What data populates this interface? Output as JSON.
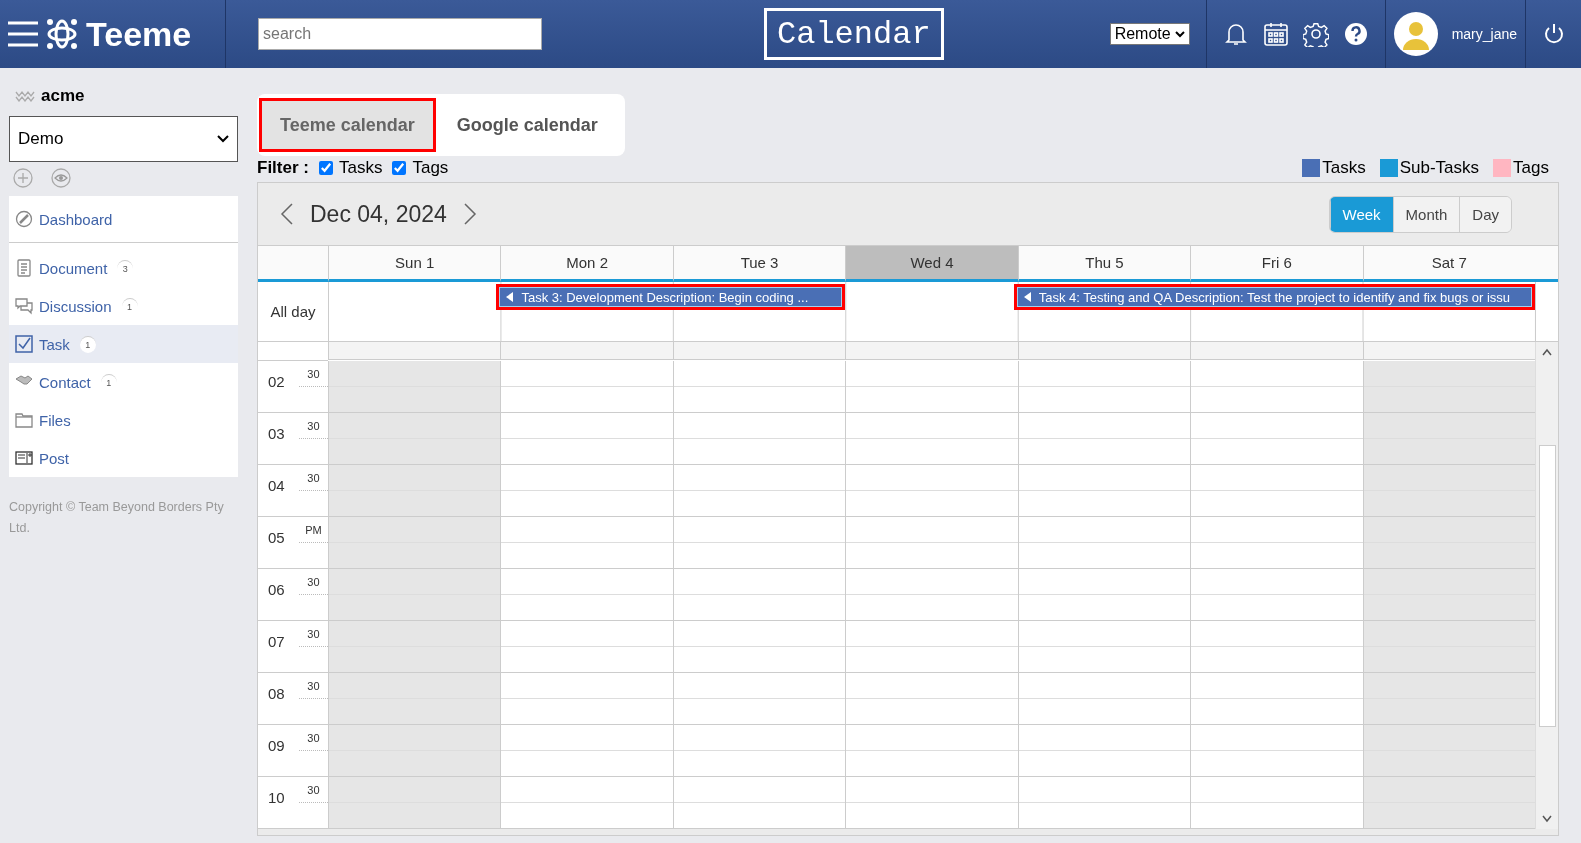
{
  "header": {
    "brand": "Teeme",
    "search": {
      "placeholder": "search"
    },
    "page_title": "Calendar",
    "mode_select": "Remote",
    "user_name": "mary_jane"
  },
  "sidebar": {
    "workspace": "acme",
    "space_select": "Demo",
    "items": [
      {
        "kind": "dashboard",
        "label": "Dashboard",
        "selected": false
      },
      {
        "kind": "document",
        "label": "Document",
        "count": "3",
        "selected": false
      },
      {
        "kind": "discussion",
        "label": "Discussion",
        "count": "1",
        "selected": false
      },
      {
        "kind": "task",
        "label": "Task",
        "count": "1",
        "selected": true
      },
      {
        "kind": "contact",
        "label": "Contact",
        "count": "1",
        "selected": false
      },
      {
        "kind": "files",
        "label": "Files",
        "selected": false
      },
      {
        "kind": "post",
        "label": "Post",
        "selected": false
      }
    ],
    "copyright": "Copyright © Team Beyond Borders Pty Ltd."
  },
  "calendar_tabs": [
    {
      "label": "Teeme calendar",
      "selected": true,
      "highlighted": true
    },
    {
      "label": "Google calendar",
      "selected": false,
      "highlighted": false
    }
  ],
  "filter": {
    "label": "Filter :",
    "options": [
      {
        "label": "Tasks",
        "checked": true
      },
      {
        "label": "Tags",
        "checked": true
      }
    ]
  },
  "legend": [
    {
      "label": "Tasks",
      "color": "#4a6fb5"
    },
    {
      "label": "Sub-Tasks",
      "color": "#1a9ad6"
    },
    {
      "label": "Tags",
      "color": "#ffb6c1"
    }
  ],
  "calendar": {
    "date": "Dec 04, 2024",
    "views": [
      {
        "label": "Week",
        "selected": true
      },
      {
        "label": "Month",
        "selected": false
      },
      {
        "label": "Day",
        "selected": false
      }
    ],
    "all_day_label": "All day",
    "days": [
      {
        "label": "Sun 1",
        "today": false,
        "weekend": true
      },
      {
        "label": "Mon 2",
        "today": false,
        "weekend": false,
        "event": {
          "title": "Task 3: Development Description: Begin coding ...",
          "highlighted": true
        }
      },
      {
        "label": "Tue 3",
        "today": false,
        "weekend": false,
        "continues": true
      },
      {
        "label": "Wed 4",
        "today": true,
        "weekend": false
      },
      {
        "label": "Thu 5",
        "today": false,
        "weekend": false,
        "event": {
          "title": "Task 4: Testing and QA Description: Test the project to identify and fix bugs or issu",
          "highlighted": true
        }
      },
      {
        "label": "Fri 6",
        "today": false,
        "weekend": false,
        "continues": true
      },
      {
        "label": "Sat 7",
        "today": false,
        "weekend": true,
        "continues": true
      }
    ],
    "hours": [
      {
        "hour": "02",
        "minute": "30"
      },
      {
        "hour": "03",
        "minute": "30"
      },
      {
        "hour": "04",
        "minute": "30"
      },
      {
        "hour": "05",
        "minute": "PM"
      },
      {
        "hour": "06",
        "minute": "30"
      },
      {
        "hour": "07",
        "minute": "30"
      },
      {
        "hour": "08",
        "minute": "30"
      },
      {
        "hour": "09",
        "minute": "30"
      },
      {
        "hour": "10",
        "minute": "30"
      }
    ]
  }
}
